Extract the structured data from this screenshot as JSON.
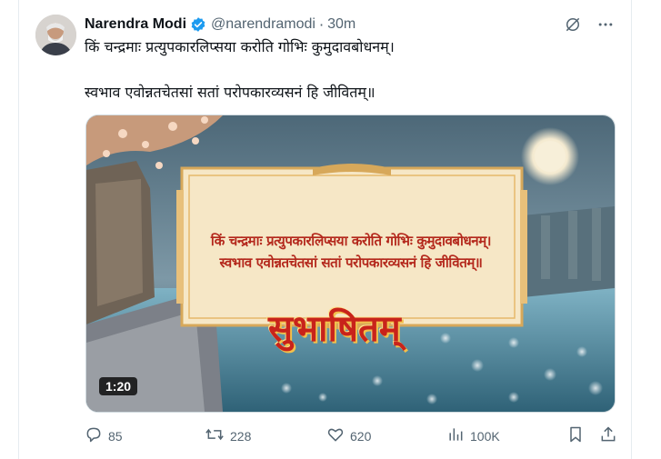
{
  "post": {
    "author_name": "Narendra Modi",
    "author_handle": "@narendramodi",
    "separator": "·",
    "time": "30m",
    "text_line1": "किं चन्द्रमाः प्रत्युपकारलिप्सया करोति गोभिः कुमुदावबोधनम्।",
    "text_line2": "स्वभाव एवोन्नतचेतसां सतां परोपकारव्यसनं हि जीवितम्॥"
  },
  "media": {
    "scroll_line1": "किं चन्द्रमाः प्रत्युपकारलिप्सया करोति गोभिः कुमुदावबोधनम्।",
    "scroll_line2": "स्वभाव एवोन्नतचेतसां सतां परोपकारव्यसनं हि जीवितम्॥",
    "title": "सुभाषितम्",
    "duration": "1:20"
  },
  "actions": {
    "replies": "85",
    "reposts": "228",
    "likes": "620",
    "views": "100K"
  },
  "icons": [
    "verified-badge-icon",
    "grok-icon",
    "more-icon",
    "reply-icon",
    "repost-icon",
    "like-icon",
    "views-icon",
    "bookmark-icon",
    "share-icon"
  ],
  "colors": {
    "verified": "#1d9bf0",
    "muted": "#536471",
    "text": "#0f1419",
    "scroll_text": "#b4281c"
  }
}
